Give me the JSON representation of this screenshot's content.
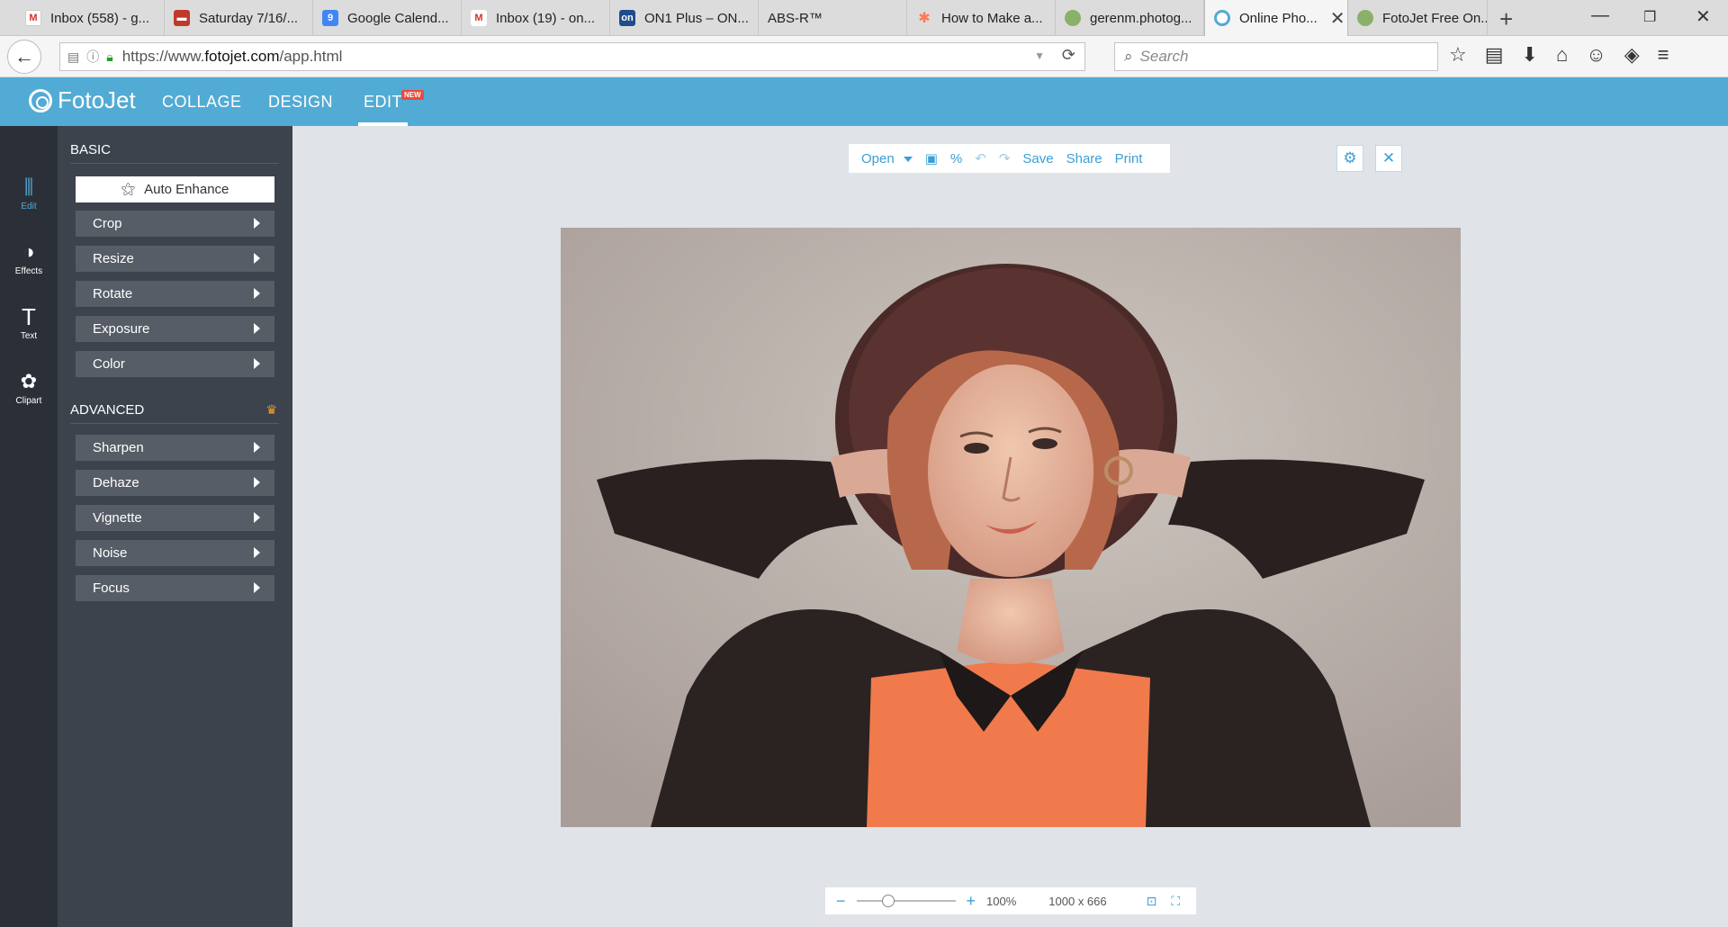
{
  "browser": {
    "tabs": [
      {
        "label": "Inbox (558) - g...",
        "icon": "gmail-icon",
        "color": "#d93025"
      },
      {
        "label": "Saturday 7/16/...",
        "icon": "calendar-page-icon",
        "color": "#c0392b"
      },
      {
        "label": "Google Calend...",
        "icon": "google-calendar-icon",
        "color": "#4285f4"
      },
      {
        "label": "Inbox (19) - on...",
        "icon": "gmail-icon",
        "color": "#d93025"
      },
      {
        "label": "ON1 Plus – ON...",
        "icon": "on1-icon",
        "color": "#1e4d8c"
      },
      {
        "label": "ABS-R™",
        "icon": "",
        "color": ""
      },
      {
        "label": "How to Make a...",
        "icon": "hubspot-icon",
        "color": "#ff7a59"
      },
      {
        "label": "gerenm.photog...",
        "icon": "tree-icon",
        "color": "#8bb06a"
      },
      {
        "label": "Online Pho...",
        "icon": "fotojet-icon",
        "color": "#52abd4"
      },
      {
        "label": "FotoJet Free On...",
        "icon": "tree-icon",
        "color": "#8bb06a"
      }
    ],
    "url_prefix": "https://www.",
    "url_domain": "fotojet.com",
    "url_path": "/app.html",
    "search_placeholder": "Search"
  },
  "app": {
    "logo_text": "FotoJet",
    "nav": [
      "COLLAGE",
      "DESIGN",
      "EDIT"
    ],
    "new_badge": "NEW",
    "rail": [
      {
        "label": "Edit",
        "icon": "sliders-icon"
      },
      {
        "label": "Effects",
        "icon": "effects-icon"
      },
      {
        "label": "Text",
        "icon": "text-icon"
      },
      {
        "label": "Clipart",
        "icon": "clipart-icon"
      }
    ],
    "basic_title": "BASIC",
    "auto_enhance": "Auto Enhance",
    "basic_tools": [
      "Crop",
      "Resize",
      "Rotate",
      "Exposure",
      "Color"
    ],
    "advanced_title": "ADVANCED",
    "advanced_tools": [
      "Sharpen",
      "Dehaze",
      "Vignette",
      "Noise",
      "Focus"
    ],
    "toolbar": {
      "open": "Open",
      "save": "Save",
      "share": "Share",
      "print": "Print"
    },
    "zoom": {
      "percent": "100%",
      "dimensions": "1000 x 666",
      "level": 1.0
    },
    "accent_color": "#52abd4"
  }
}
